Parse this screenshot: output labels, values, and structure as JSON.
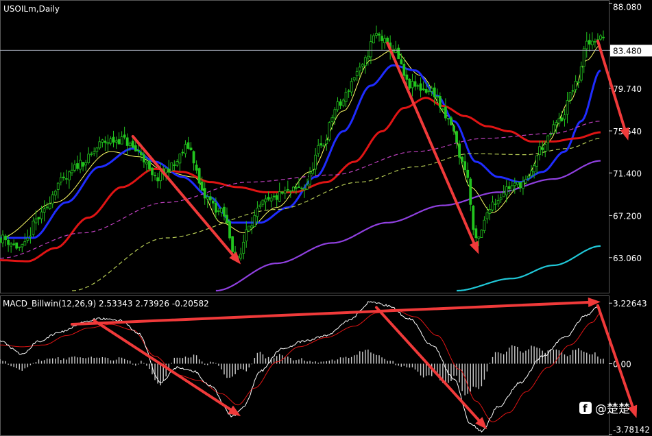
{
  "header": {
    "symbol_title": "USOILm,Daily",
    "indicator_title": "MACD_Billwin(12,26,9) 2.53343 2.73926 -0.20582"
  },
  "watermark": {
    "text": "@楚楚"
  },
  "colors": {
    "background": "#000000",
    "candle": "#22c41e",
    "ma_short": "#ffff66",
    "ma_blue": "#1f2cff",
    "ma_red": "#e01414",
    "ma_magenta_dashed": "#c040c0",
    "ma_olive_dashed": "#b7cc55",
    "ma_violet": "#9040e0",
    "ma_cyan": "#20c8d8",
    "macd_line": "#ffffff",
    "signal_line": "#e01414",
    "histogram": "#cfcfcf",
    "arrows": "#f03a3a",
    "current_price_line": "#aab0c0"
  },
  "chart_data": [
    {
      "type": "candlestick",
      "instrument": "USOILm",
      "timeframe": "Daily",
      "y_axis_ticks": [
        "88.080",
        "83.480",
        "79.740",
        "75.540",
        "71.400",
        "67.200",
        "63.060"
      ],
      "current_price": "83.480",
      "ylim": [
        59.6,
        88.3
      ],
      "x_range": [
        0,
        218
      ],
      "grid": false,
      "close_anchors": [
        [
          0,
          65.0
        ],
        [
          8,
          64.0
        ],
        [
          14,
          67.0
        ],
        [
          22,
          70.5
        ],
        [
          30,
          72.5
        ],
        [
          38,
          74.5
        ],
        [
          44,
          74.7
        ],
        [
          50,
          73.5
        ],
        [
          56,
          70.8
        ],
        [
          62,
          72.0
        ],
        [
          68,
          74.0
        ],
        [
          74,
          69.0
        ],
        [
          80,
          67.5
        ],
        [
          86,
          62.8
        ],
        [
          90,
          66.5
        ],
        [
          96,
          68.5
        ],
        [
          104,
          69.5
        ],
        [
          110,
          70.0
        ],
        [
          116,
          74.0
        ],
        [
          122,
          78.0
        ],
        [
          130,
          81.5
        ],
        [
          136,
          85.0
        ],
        [
          142,
          83.5
        ],
        [
          148,
          80.0
        ],
        [
          156,
          79.5
        ],
        [
          162,
          76.5
        ],
        [
          168,
          72.0
        ],
        [
          172,
          64.6
        ],
        [
          178,
          68.5
        ],
        [
          184,
          70.0
        ],
        [
          190,
          70.5
        ],
        [
          196,
          74.0
        ],
        [
          202,
          76.5
        ],
        [
          208,
          80.0
        ],
        [
          212,
          84.0
        ],
        [
          216,
          84.8
        ]
      ],
      "series": [
        {
          "name": "",
          "style": "yellow-thin",
          "anchors": [
            [
              0,
              65.0
            ],
            [
              20,
              68.5
            ],
            [
              40,
              73.5
            ],
            [
              50,
              73.0
            ],
            [
              60,
              71.5
            ],
            [
              70,
              71.0
            ],
            [
              80,
              66.5
            ],
            [
              88,
              65.5
            ],
            [
              100,
              68.0
            ],
            [
              112,
              71.5
            ],
            [
              124,
              77.5
            ],
            [
              134,
              82.5
            ],
            [
              142,
              83.5
            ],
            [
              152,
              81.0
            ],
            [
              162,
              77.0
            ],
            [
              170,
              70.0
            ],
            [
              178,
              67.5
            ],
            [
              188,
              70.0
            ],
            [
              198,
              74.5
            ],
            [
              206,
              78.5
            ],
            [
              212,
              82.5
            ],
            [
              217,
              84.0
            ]
          ]
        },
        {
          "name": "",
          "style": "blue-thick",
          "anchors": [
            [
              0,
              65.0
            ],
            [
              12,
              65.0
            ],
            [
              24,
              68.5
            ],
            [
              36,
              72.0
            ],
            [
              48,
              73.8
            ],
            [
              56,
              72.5
            ],
            [
              66,
              71.0
            ],
            [
              76,
              69.0
            ],
            [
              84,
              66.5
            ],
            [
              94,
              66.5
            ],
            [
              104,
              68.0
            ],
            [
              114,
              71.0
            ],
            [
              124,
              75.5
            ],
            [
              134,
              80.0
            ],
            [
              142,
              82.0
            ],
            [
              150,
              81.5
            ],
            [
              158,
              79.0
            ],
            [
              164,
              76.5
            ],
            [
              172,
              72.5
            ],
            [
              180,
              71.0
            ],
            [
              188,
              70.5
            ],
            [
              196,
              71.5
            ],
            [
              204,
              73.5
            ],
            [
              210,
              76.5
            ],
            [
              217,
              81.5
            ]
          ]
        },
        {
          "name": "",
          "style": "red-thick",
          "anchors": [
            [
              0,
              62.8
            ],
            [
              10,
              62.7
            ],
            [
              20,
              64.0
            ],
            [
              32,
              67.0
            ],
            [
              44,
              70.0
            ],
            [
              56,
              71.8
            ],
            [
              66,
              71.5
            ],
            [
              76,
              70.5
            ],
            [
              86,
              70.0
            ],
            [
              96,
              69.5
            ],
            [
              106,
              69.5
            ],
            [
              118,
              70.5
            ],
            [
              128,
              72.5
            ],
            [
              138,
              75.5
            ],
            [
              146,
              77.8
            ],
            [
              154,
              78.8
            ],
            [
              160,
              78.0
            ],
            [
              168,
              77.0
            ],
            [
              176,
              76.0
            ],
            [
              184,
              75.5
            ],
            [
              192,
              74.5
            ],
            [
              200,
              74.5
            ],
            [
              208,
              74.8
            ],
            [
              217,
              75.4
            ]
          ]
        },
        {
          "name": "",
          "style": "magenta-dashed",
          "anchors": [
            [
              0,
              63.0
            ],
            [
              30,
              65.5
            ],
            [
              60,
              68.5
            ],
            [
              90,
              70.5
            ],
            [
              120,
              71.2
            ],
            [
              150,
              73.5
            ],
            [
              175,
              74.8
            ],
            [
              200,
              75.3
            ],
            [
              217,
              76.5
            ]
          ]
        },
        {
          "name": "",
          "style": "olive-dashed",
          "anchors": [
            [
              26,
              59.8
            ],
            [
              60,
              65.0
            ],
            [
              100,
              67.8
            ],
            [
              130,
              70.5
            ],
            [
              150,
              72.0
            ],
            [
              170,
              73.3
            ],
            [
              190,
              73.2
            ],
            [
              205,
              73.8
            ],
            [
              217,
              74.8
            ]
          ]
        },
        {
          "name": "",
          "style": "violet",
          "anchors": [
            [
              78,
              59.8
            ],
            [
              100,
              62.5
            ],
            [
              120,
              64.5
            ],
            [
              140,
              66.5
            ],
            [
              160,
              68.2
            ],
            [
              180,
              69.5
            ],
            [
              200,
              70.8
            ],
            [
              217,
              72.6
            ]
          ]
        },
        {
          "name": "",
          "style": "cyan",
          "anchors": [
            [
              165,
              59.8
            ],
            [
              185,
              61.0
            ],
            [
              200,
              62.3
            ],
            [
              217,
              64.2
            ]
          ]
        }
      ]
    },
    {
      "type": "line+histogram",
      "indicator": "MACD_Billwin",
      "params": [
        12,
        26,
        9
      ],
      "values": {
        "macd": 2.53343,
        "signal": 2.73926,
        "histogram": -0.20582
      },
      "y_axis_ticks": [
        "3.22643",
        "0.00",
        "-3.78142"
      ],
      "ylim": [
        -3.78142,
        3.6
      ],
      "x_range": [
        0,
        218
      ],
      "macd_anchors": [
        [
          0,
          1.2
        ],
        [
          8,
          0.5
        ],
        [
          14,
          1.2
        ],
        [
          22,
          1.7
        ],
        [
          30,
          2.2
        ],
        [
          36,
          2.4
        ],
        [
          44,
          2.3
        ],
        [
          50,
          1.6
        ],
        [
          58,
          -1.0
        ],
        [
          64,
          -0.2
        ],
        [
          70,
          -0.4
        ],
        [
          76,
          -1.2
        ],
        [
          84,
          -2.8
        ],
        [
          88,
          -2.3
        ],
        [
          94,
          -0.4
        ],
        [
          102,
          0.8
        ],
        [
          110,
          1.2
        ],
        [
          118,
          1.5
        ],
        [
          126,
          2.3
        ],
        [
          134,
          3.3
        ],
        [
          140,
          3.1
        ],
        [
          148,
          2.4
        ],
        [
          156,
          1.0
        ],
        [
          164,
          -0.8
        ],
        [
          170,
          -3.2
        ],
        [
          174,
          -3.6
        ],
        [
          180,
          -2.3
        ],
        [
          188,
          -1.0
        ],
        [
          196,
          0.4
        ],
        [
          204,
          1.4
        ],
        [
          212,
          2.6
        ],
        [
          216,
          3.0
        ]
      ],
      "signal_anchors": [
        [
          0,
          1.0
        ],
        [
          8,
          0.9
        ],
        [
          16,
          1.0
        ],
        [
          24,
          1.5
        ],
        [
          32,
          1.9
        ],
        [
          40,
          2.1
        ],
        [
          48,
          1.8
        ],
        [
          56,
          0.4
        ],
        [
          64,
          -0.6
        ],
        [
          72,
          -0.9
        ],
        [
          80,
          -1.6
        ],
        [
          86,
          -2.2
        ],
        [
          92,
          -1.3
        ],
        [
          100,
          0.1
        ],
        [
          108,
          0.9
        ],
        [
          118,
          1.4
        ],
        [
          128,
          2.0
        ],
        [
          136,
          2.7
        ],
        [
          142,
          2.9
        ],
        [
          150,
          2.5
        ],
        [
          158,
          1.5
        ],
        [
          166,
          -0.3
        ],
        [
          172,
          -2.0
        ],
        [
          178,
          -3.1
        ],
        [
          184,
          -2.6
        ],
        [
          190,
          -1.5
        ],
        [
          198,
          -0.2
        ],
        [
          206,
          1.0
        ],
        [
          214,
          2.2
        ],
        [
          217,
          2.7
        ]
      ]
    }
  ]
}
